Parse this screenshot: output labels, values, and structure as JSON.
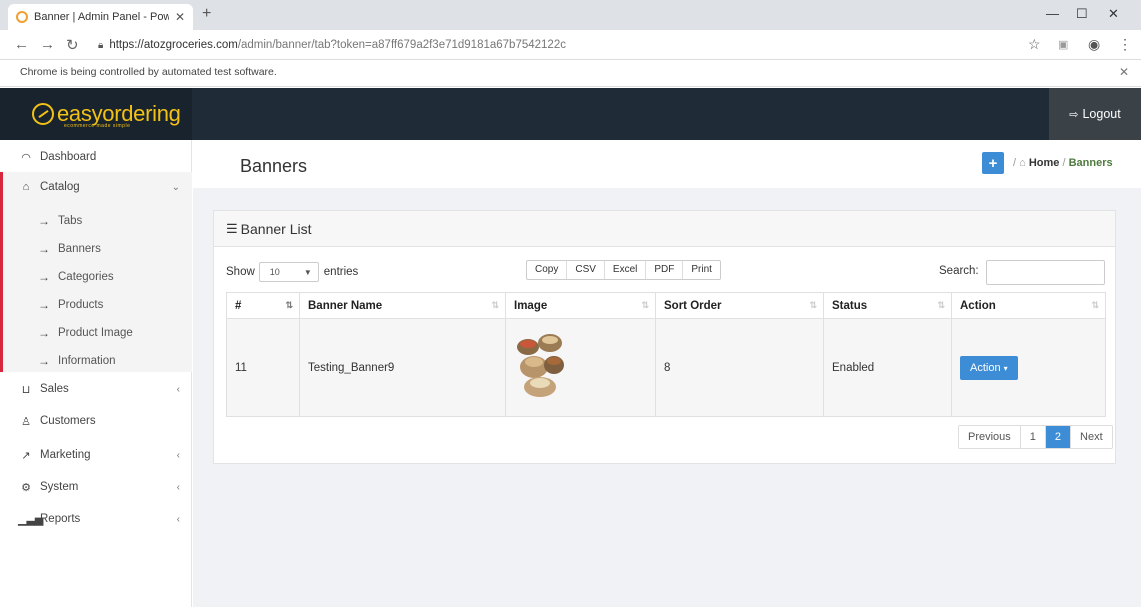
{
  "browser": {
    "tab_title": "Banner | Admin Panel - Powered",
    "url_host": "https://atozgroceries.com",
    "url_path": "/admin/banner/tab?token=a87ff679a2f3e71d9181a67b7542122c",
    "automation_notice": "Chrome is being controlled by automated test software."
  },
  "header": {
    "logo_text": "easyordering",
    "logo_tagline": "ecommerce made simple",
    "logout_label": "Logout"
  },
  "sidebar": {
    "dashboard": "Dashboard",
    "catalog": "Catalog",
    "catalog_items": [
      "Tabs",
      "Banners",
      "Categories",
      "Products",
      "Product Image",
      "Information"
    ],
    "sales": "Sales",
    "customers": "Customers",
    "marketing": "Marketing",
    "system": "System",
    "reports": "Reports"
  },
  "page": {
    "title": "Banners",
    "breadcrumb": {
      "home": "Home",
      "current": "Banners"
    }
  },
  "list": {
    "title": "Banner List",
    "show_label": "Show",
    "entries_value": "10",
    "entries_label": "entries",
    "export_buttons": [
      "Copy",
      "CSV",
      "Excel",
      "PDF",
      "Print"
    ],
    "search_label": "Search:",
    "columns": [
      "#",
      "Banner Name",
      "Image",
      "Sort Order",
      "Status",
      "Action"
    ],
    "rows": [
      {
        "id": "11",
        "name": "Testing_Banner9",
        "sort_order": "8",
        "status": "Enabled",
        "action_label": "Action"
      }
    ],
    "pagination": {
      "previous": "Previous",
      "pages": [
        "1",
        "2"
      ],
      "next": "Next",
      "active_page": "2"
    }
  },
  "colors": {
    "header_bg": "#1f2b36",
    "logo_accent": "#f2c116",
    "primary_button": "#3c8dd6",
    "sidebar_active_border": "#d6273e"
  }
}
